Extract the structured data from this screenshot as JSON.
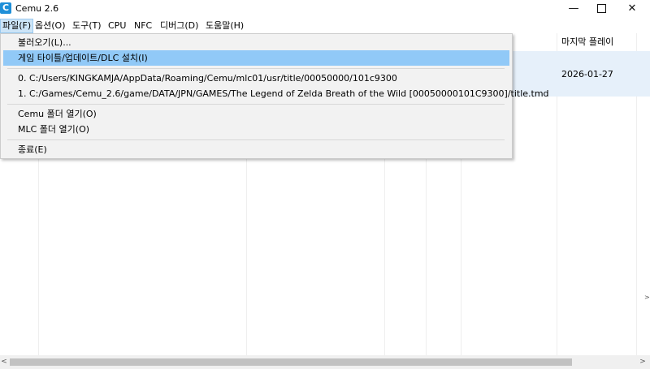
{
  "window": {
    "title": "Cemu 2.6",
    "app_icon_letter": "C",
    "minimize": "—",
    "close": "✕"
  },
  "menubar": {
    "items": [
      {
        "label": "파일(F)"
      },
      {
        "label": "옵션(O)"
      },
      {
        "label": "도구(T)"
      },
      {
        "label": "CPU"
      },
      {
        "label": "NFC"
      },
      {
        "label": "디버그(D)"
      },
      {
        "label": "도움말(H)"
      }
    ]
  },
  "game_list": {
    "columns": [
      {
        "label": "마지막 플레이"
      }
    ],
    "rows": [
      {
        "last_played": "2026-01-27"
      }
    ]
  },
  "file_menu": {
    "items": [
      {
        "label": "불러오기(L)..."
      },
      {
        "label": "게임 타이틀/업데이트/DLC 설치(I)"
      },
      {
        "label": "0. C:/Users/KINGKAMJA/AppData/Roaming/Cemu/mlc01/usr/title/00050000/101c9300"
      },
      {
        "label": "1. C:/Games/Cemu_2.6/game/DATA/JPN/GAMES/The Legend of Zelda Breath of the Wild [00050000101C9300]/title.tmd"
      },
      {
        "label": "Cemu 폴더 열기(O)"
      },
      {
        "label": "MLC 폴더 열기(O)"
      },
      {
        "label": "종료(E)"
      }
    ]
  },
  "colors": {
    "menu_highlight": "#91c9f7",
    "active_menu": "#cce4f7",
    "app_icon": "#1e8fd8"
  }
}
